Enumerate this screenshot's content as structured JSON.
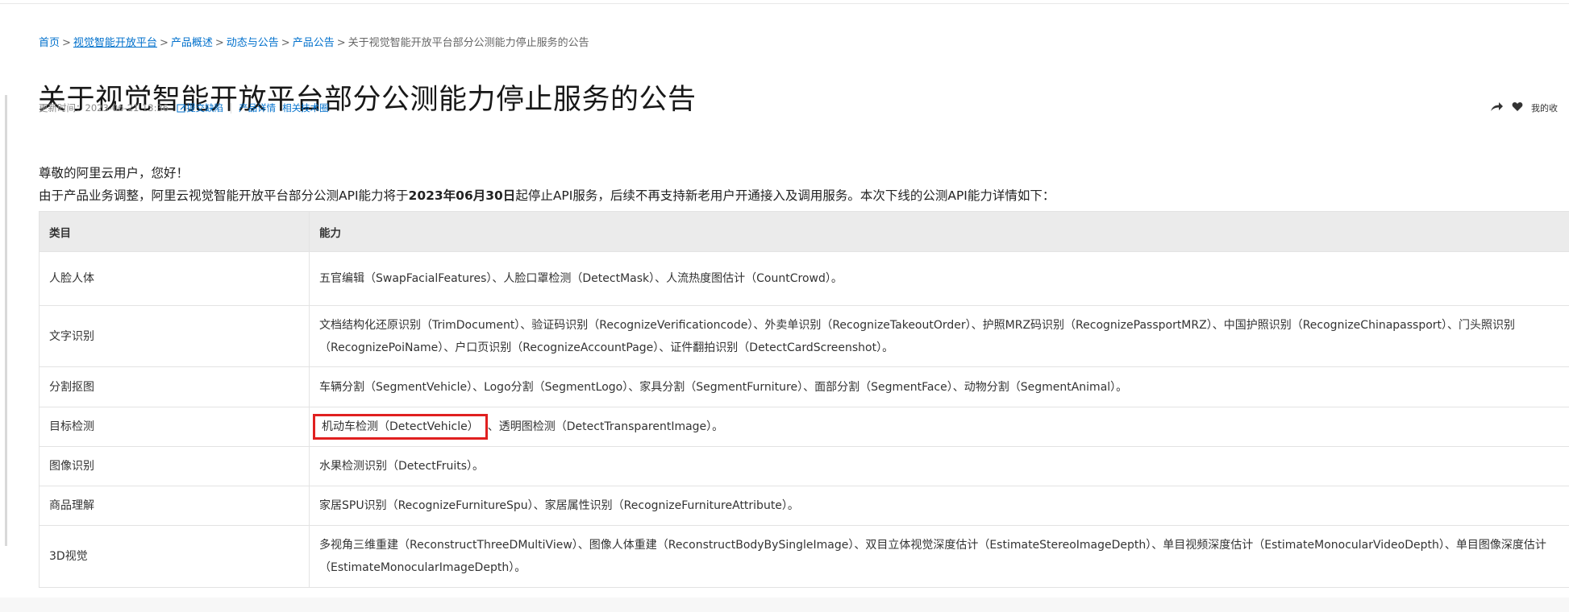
{
  "breadcrumb": {
    "items": [
      "首页",
      "视觉智能开放平台",
      "产品概述",
      "动态与公告",
      "产品公告"
    ],
    "current": "关于视觉智能开放平台部分公测能力停止服务的公告",
    "separator": ">"
  },
  "page_title": "关于视觉智能开放平台部分公测能力停止服务的公告",
  "meta": {
    "updated": "更新时间：2023-06-21 13:36",
    "report_link": "提交缺陷",
    "product_link": "产品详情",
    "community_link": "相关技术圈"
  },
  "actions": {
    "share_icon": "share-icon",
    "favorite_icon": "heart-icon",
    "favorites_label": "我的收"
  },
  "intro": {
    "greeting": "尊敬的阿里云用户，您好！",
    "notice_before": "由于产品业务调整，阿里云视觉智能开放平台部分公测API能力将于",
    "notice_date": "2023年06月30日",
    "notice_after": "起停止API服务，后续不再支持新老用户开通接入及调用服务。本次下线的公测API能力详情如下："
  },
  "table": {
    "headers": [
      "类目",
      "能力"
    ],
    "rows": [
      {
        "category": "人脸人体",
        "capability": "五官编辑（SwapFacialFeatures）、人脸口罩检测（DetectMask）、人流热度图估计（CountCrowd）。"
      },
      {
        "category": "文字识别",
        "capability_lines": [
          "文档结构化还原识别（TrimDocument）、验证码识别（RecognizeVerificationcode）、外卖单识别（RecognizeTakeoutOrder）、护照MRZ码识别（RecognizePassportMRZ）、中国护照识别（RecognizeChinapassport）、门头照识别",
          "（RecognizePoiName）、户口页识别（RecognizeAccountPage）、证件翻拍识别（DetectCardScreenshot）。"
        ]
      },
      {
        "category": "分割抠图",
        "capability": "车辆分割（SegmentVehicle）、Logo分割（SegmentLogo）、家具分割（SegmentFurniture）、面部分割（SegmentFace）、动物分割（SegmentAnimal）。"
      },
      {
        "category": "目标检测",
        "capability_highlight": "机动车检测（DetectVehicle）",
        "capability_rest": "、透明图检测（DetectTransparentImage）。"
      },
      {
        "category": "图像识别",
        "capability": "水果检测识别（DetectFruits）。"
      },
      {
        "category": "商品理解",
        "capability": "家居SPU识别（RecognizeFurnitureSpu）、家居属性识别（RecognizeFurnitureAttribute）。"
      },
      {
        "category": "3D视觉",
        "capability_lines": [
          "多视角三维重建（ReconstructThreeDMultiView）、图像人体重建（ReconstructBodyBySingleImage）、双目立体视觉深度估计（EstimateStereoImageDepth）、单目视频深度估计（EstimateMonocularVideoDepth）、单目图像深度估计",
          "（EstimateMonocularImageDepth）。"
        ]
      }
    ]
  },
  "colors": {
    "link": "#0070cc",
    "highlight_border": "#e02020",
    "header_bg": "#ebebeb"
  }
}
